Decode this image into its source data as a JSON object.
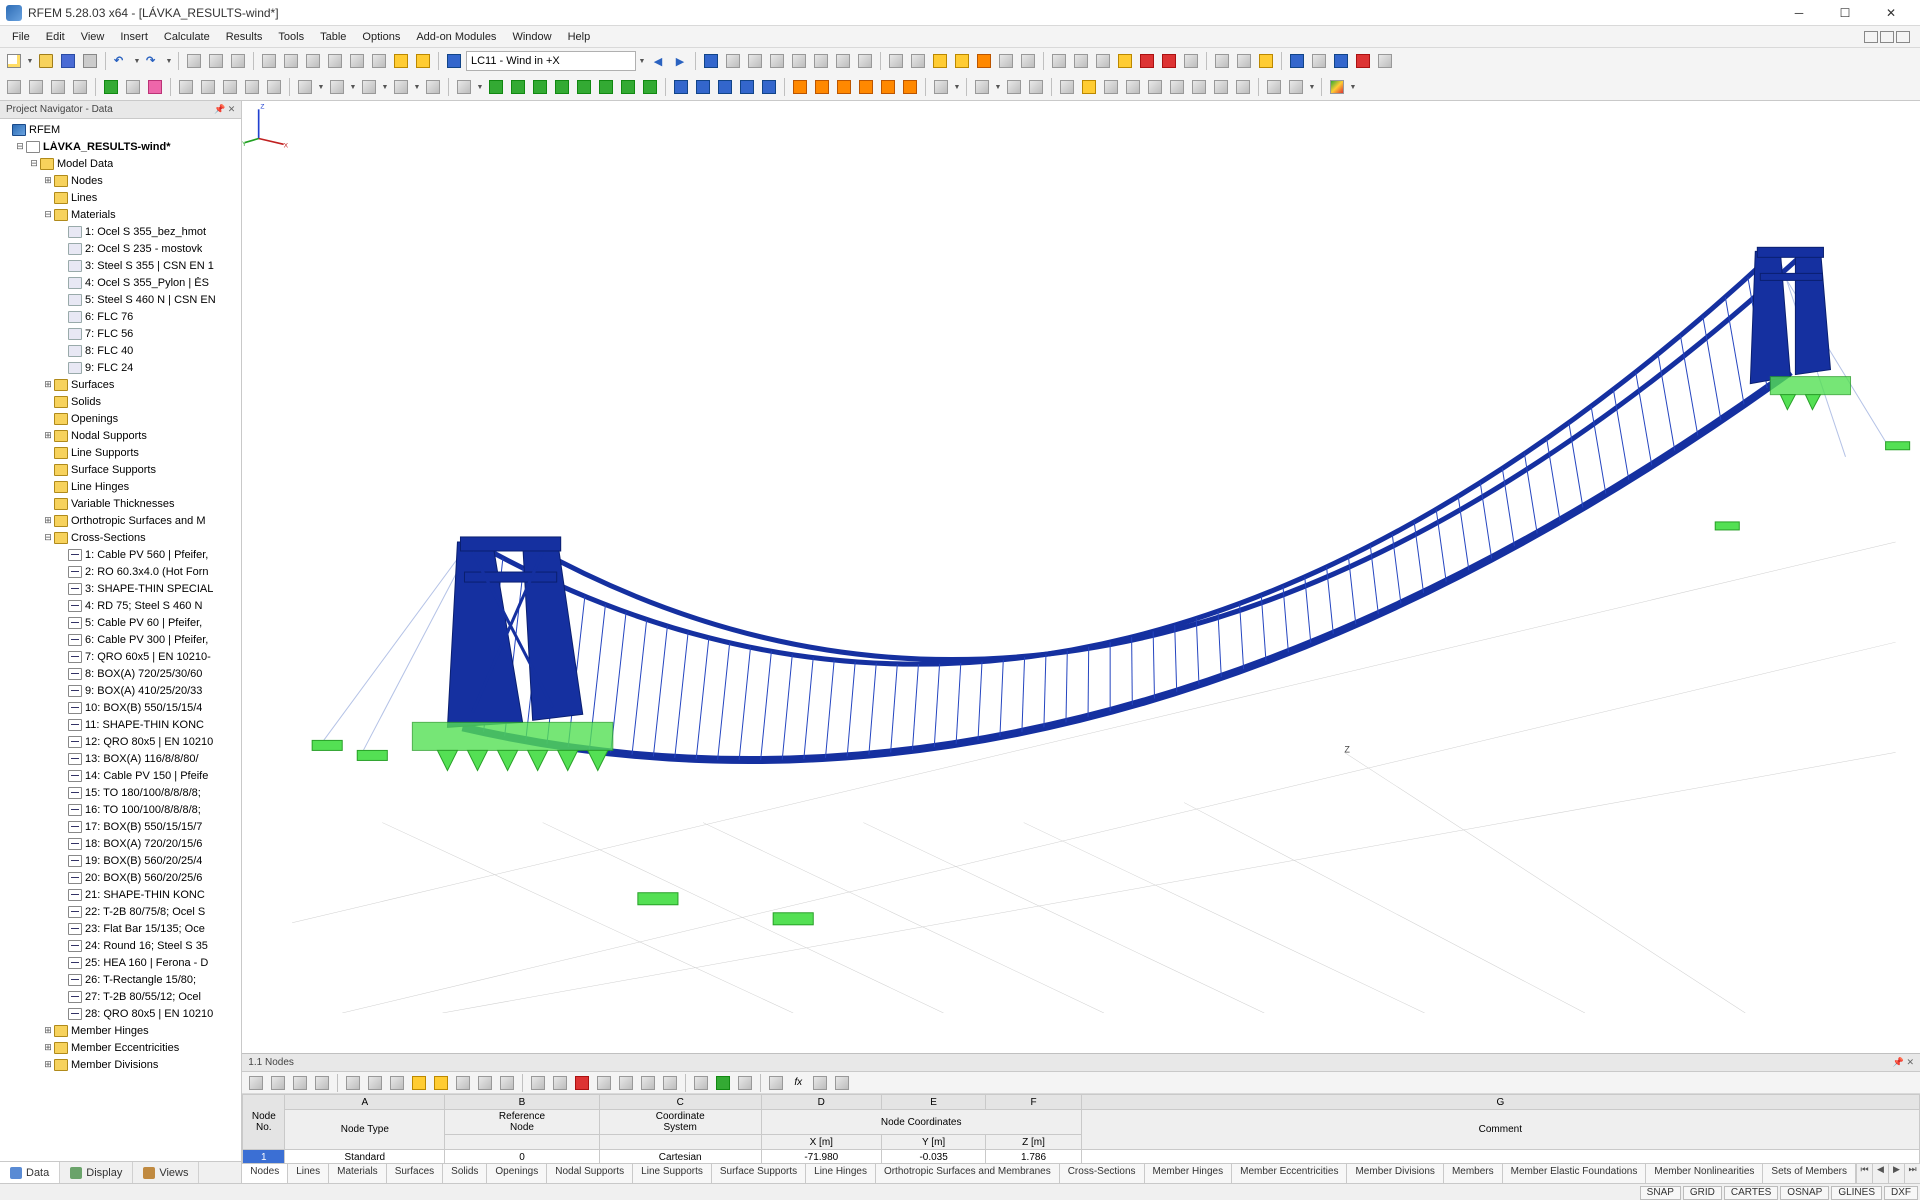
{
  "app": {
    "title": "RFEM 5.28.03 x64 - [LÁVKA_RESULTS-wind*]"
  },
  "menu": [
    "File",
    "Edit",
    "View",
    "Insert",
    "Calculate",
    "Results",
    "Tools",
    "Table",
    "Options",
    "Add-on Modules",
    "Window",
    "Help"
  ],
  "loadcase_combo": "LC11 - Wind in +X",
  "navigator": {
    "title": "Project Navigator - Data",
    "root": "RFEM",
    "model": "LÁVKA_RESULTS-wind*",
    "model_data": "Model Data",
    "nodes": "Nodes",
    "lines": "Lines",
    "materials_label": "Materials",
    "materials": [
      "1: Ocel S 355_bez_hmot",
      "2: Ocel S 235 - mostovk",
      "3: Steel S 355 | CSN EN 1",
      "4: Ocel S 355_Pylon | ĚS",
      "5: Steel S 460 N | CSN EN",
      "6: FLC 76",
      "7: FLC 56",
      "8: FLC 40",
      "9: FLC 24"
    ],
    "surfaces": "Surfaces",
    "solids": "Solids",
    "openings": "Openings",
    "nodal_supports": "Nodal Supports",
    "line_supports": "Line Supports",
    "surface_supports": "Surface Supports",
    "line_hinges": "Line Hinges",
    "var_thick": "Variable Thicknesses",
    "ortho": "Orthotropic Surfaces and M",
    "cross_label": "Cross-Sections",
    "cross": [
      "1: Cable PV 560 | Pfeifer,",
      "2: RO 60.3x4.0 (Hot Forn",
      "3: SHAPE-THIN SPECIAL",
      "4: RD 75; Steel S 460 N",
      "5: Cable PV 60 | Pfeifer,",
      "6: Cable PV 300 | Pfeifer,",
      "7: QRO 60x5 | EN 10210-",
      "8: BOX(A) 720/25/30/60",
      "9: BOX(A) 410/25/20/33",
      "10: BOX(B) 550/15/15/4",
      "11: SHAPE-THIN KONC",
      "12: QRO 80x5 | EN 10210",
      "13: BOX(A) 116/8/8/80/",
      "14: Cable PV 150 | Pfeife",
      "15: TO 180/100/8/8/8/8;",
      "16: TO 100/100/8/8/8/8;",
      "17: BOX(B) 550/15/15/7",
      "18: BOX(A) 720/20/15/6",
      "19: BOX(B) 560/20/25/4",
      "20: BOX(B) 560/20/25/6",
      "21: SHAPE-THIN KONC",
      "22: T-2B 80/75/8; Ocel S",
      "23: Flat Bar 15/135; Oce",
      "24: Round 16; Steel S 35",
      "25: HEA 160 | Ferona - D",
      "26: T-Rectangle 15/80;",
      "27: T-2B 80/55/12; Ocel",
      "28: QRO 80x5 | EN 10210"
    ],
    "member_hinges": "Member Hinges",
    "member_ecc": "Member Eccentricities",
    "member_div": "Member Divisions",
    "tabs": {
      "data": "Data",
      "display": "Display",
      "views": "Views"
    }
  },
  "datapanel": {
    "title": "1.1 Nodes",
    "cols": [
      "A",
      "B",
      "C",
      "D",
      "E",
      "F",
      "G"
    ],
    "header1": {
      "node_no": "Node\nNo.",
      "ref_node": "Reference\nNode",
      "coord_sys": "Coordinate\nSystem",
      "node_coords": "Node Coordinates",
      "comment": "Comment"
    },
    "header2": {
      "node_type": "Node Type",
      "x": "X [m]",
      "y": "Y [m]",
      "z": "Z [m]"
    },
    "row": {
      "no": "1",
      "type": "Standard",
      "ref": "0",
      "sys": "Cartesian",
      "x": "-71.980",
      "y": "-0.035",
      "z": "1.786",
      "comment": ""
    },
    "tabs": [
      "Nodes",
      "Lines",
      "Materials",
      "Surfaces",
      "Solids",
      "Openings",
      "Nodal Supports",
      "Line Supports",
      "Surface Supports",
      "Line Hinges",
      "Orthotropic Surfaces and Membranes",
      "Cross-Sections",
      "Member Hinges",
      "Member Eccentricities",
      "Member Divisions",
      "Members",
      "Member Elastic Foundations",
      "Member Nonlinearities",
      "Sets of Members"
    ]
  },
  "status": [
    "SNAP",
    "GRID",
    "CARTES",
    "OSNAP",
    "GLINES",
    "DXF"
  ],
  "axes": {
    "x": "X",
    "y": "Y",
    "z": "Z"
  }
}
